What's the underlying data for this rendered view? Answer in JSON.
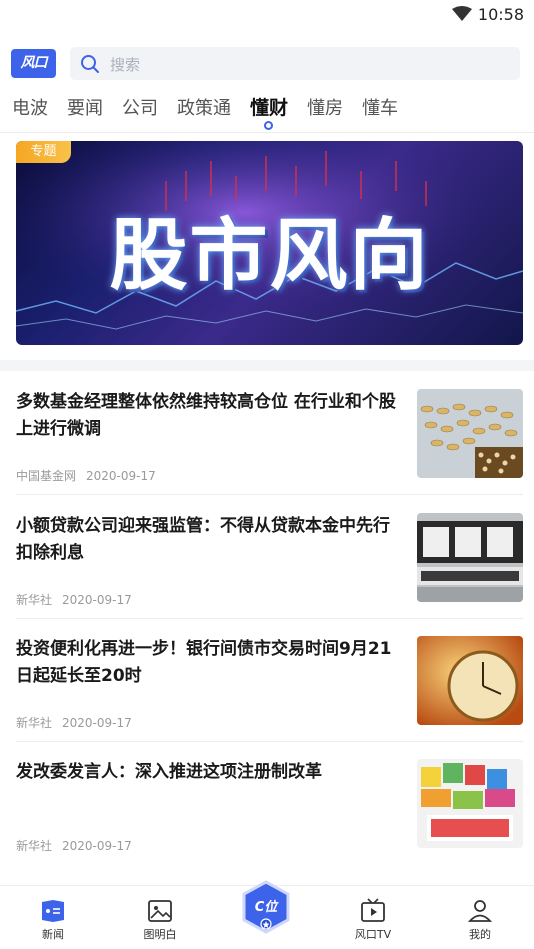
{
  "status_bar": {
    "time": "10:58"
  },
  "header": {
    "logo": "风口",
    "search_placeholder": "搜索"
  },
  "tabs": [
    {
      "label": "电波",
      "active": false
    },
    {
      "label": "要闻",
      "active": false
    },
    {
      "label": "公司",
      "active": false
    },
    {
      "label": "政策通",
      "active": false
    },
    {
      "label": "懂财",
      "active": true
    },
    {
      "label": "懂房",
      "active": false
    },
    {
      "label": "懂车",
      "active": false
    }
  ],
  "banner": {
    "tag": "专题",
    "title": "股市风向"
  },
  "news": [
    {
      "title": "多数基金经理整体依然维持较高仓位 在行业和个股上进行微调",
      "source": "中国基金网",
      "date": "2020-09-17",
      "thumb": "coins-abacus"
    },
    {
      "title": "小额贷款公司迎来强监管：不得从贷款本金中先行扣除利息",
      "source": "新华社",
      "date": "2020-09-17",
      "thumb": "micro-credit-sign"
    },
    {
      "title": "投资便利化再进一步！银行间债市交易时间9月21日起延长至20时",
      "source": "新华社",
      "date": "2020-09-17",
      "thumb": "clock"
    },
    {
      "title": "发改委发言人：深入推进这项注册制改革",
      "source": "新华社",
      "date": "2020-09-17",
      "thumb": "ipo-blocks"
    }
  ],
  "bottom_nav": [
    {
      "label": "新闻",
      "icon": "news-icon",
      "active": true
    },
    {
      "label": "图明白",
      "icon": "image-icon",
      "active": false
    },
    {
      "label": "C位",
      "icon": "c-badge-icon",
      "active": false
    },
    {
      "label": "风口TV",
      "icon": "tv-icon",
      "active": false
    },
    {
      "label": "我的",
      "icon": "user-icon",
      "active": false
    }
  ],
  "colors": {
    "accent": "#3d63ea",
    "tag": "#f6a623"
  }
}
